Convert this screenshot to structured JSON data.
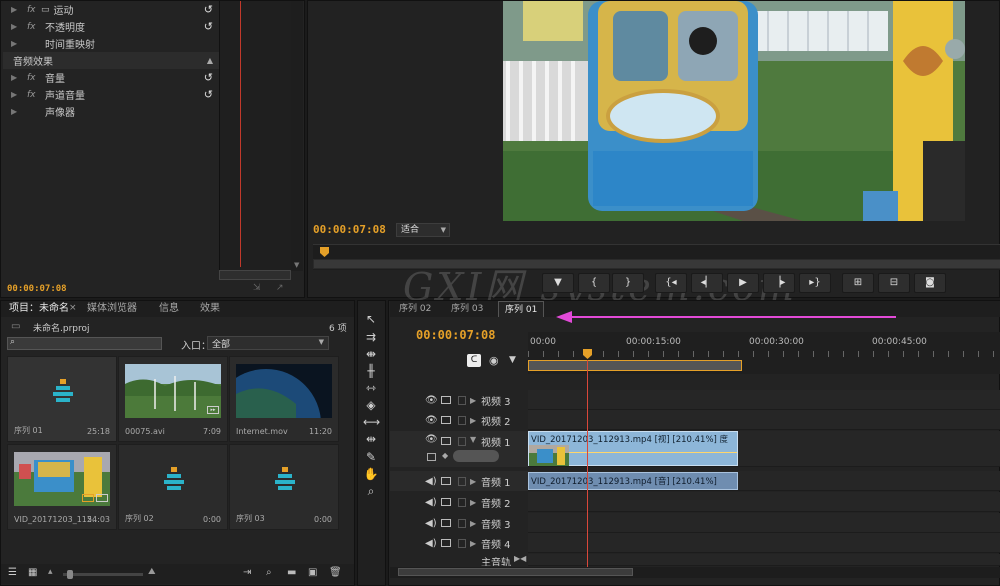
{
  "effect_controls": {
    "rows": [
      {
        "label": "运动",
        "fx": "fx",
        "reset": true
      },
      {
        "label": "不透明度",
        "fx": "fx",
        "reset": true
      },
      {
        "label": "时间重映射",
        "fx": "",
        "reset": false
      }
    ],
    "audio_section": "音频效果",
    "audio_rows": [
      {
        "label": "音量",
        "fx": "fx",
        "reset": true
      },
      {
        "label": "声道音量",
        "fx": "fx",
        "reset": true
      },
      {
        "label": "声像器",
        "fx": "",
        "reset": false
      }
    ],
    "timecode": "00:00:07:08"
  },
  "program_monitor": {
    "timecode": "00:00:07:08",
    "fit_select": "适合",
    "transport_icons": [
      "marker-icon",
      "in-point-icon",
      "out-point-icon",
      "go-to-in-icon",
      "step-back-icon",
      "play-icon",
      "step-forward-icon",
      "go-to-out-icon",
      "lift-icon",
      "extract-icon",
      "export-frame-icon"
    ]
  },
  "project_panel": {
    "tabs": [
      "项目：未命名",
      "媒体浏览器",
      "信息",
      "效果"
    ],
    "project_file": "未命名.prproj",
    "item_count": "6 项",
    "search_placeholder": "",
    "entry_label": "入口：",
    "entry_value": "全部",
    "items": [
      {
        "name": "序列 01",
        "duration": "25:18",
        "kind": "sequence"
      },
      {
        "name": "00075.avi",
        "duration": "7:09",
        "kind": "video-grass"
      },
      {
        "name": "Internet.mov",
        "duration": "11:20",
        "kind": "video-earth"
      },
      {
        "name": "VID_20171203_112...",
        "duration": "54:03",
        "kind": "video-playground"
      },
      {
        "name": "序列 02",
        "duration": "0:00",
        "kind": "sequence"
      },
      {
        "name": "序列 03",
        "duration": "0:00",
        "kind": "sequence"
      }
    ]
  },
  "timeline": {
    "tabs": [
      "序列 02",
      "序列 03",
      "序列 01"
    ],
    "timecode": "00:00:07:08",
    "ruler": [
      "00:00",
      "00:00:15:00",
      "00:00:30:00",
      "00:00:45:00"
    ],
    "video_tracks": [
      "视频 3",
      "视频 2",
      "视频 1"
    ],
    "audio_tracks": [
      "音频 1",
      "音频 2",
      "音频 3",
      "音频 4"
    ],
    "master_track": "主音轨",
    "video_clip": "VID_20171203_112913.mp4 [视] [210.41%] 度",
    "audio_clip": "VID_20171203_112913.mp4 [音] [210.41%]"
  },
  "watermark": "GXI网 system.com",
  "colors": {
    "accent": "#e5a028",
    "clip_video": "#8db6d8",
    "clip_audio": "#6f8db0",
    "playhead": "#d9473a",
    "arrow": "#e24ad8"
  }
}
